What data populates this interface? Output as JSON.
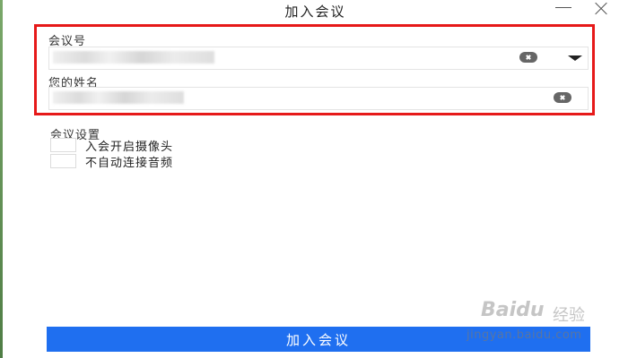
{
  "window": {
    "title": "加入会议"
  },
  "form": {
    "meeting_id": {
      "label": "会议号",
      "value": "··· ··· ···"
    },
    "name": {
      "label": "您的姓名",
      "value": "·········"
    }
  },
  "settings": {
    "title": "会议设置",
    "options": [
      {
        "label": "入会开启摄像头",
        "checked": false
      },
      {
        "label": "不自动连接音频",
        "checked": false
      }
    ]
  },
  "join_button": {
    "label": "加入会议"
  },
  "watermark": {
    "logo": "Baidu",
    "text": "经验",
    "url": "jingyan.baidu.com"
  },
  "colors": {
    "primary": "#1f6ff0",
    "highlight": "#e61919"
  }
}
